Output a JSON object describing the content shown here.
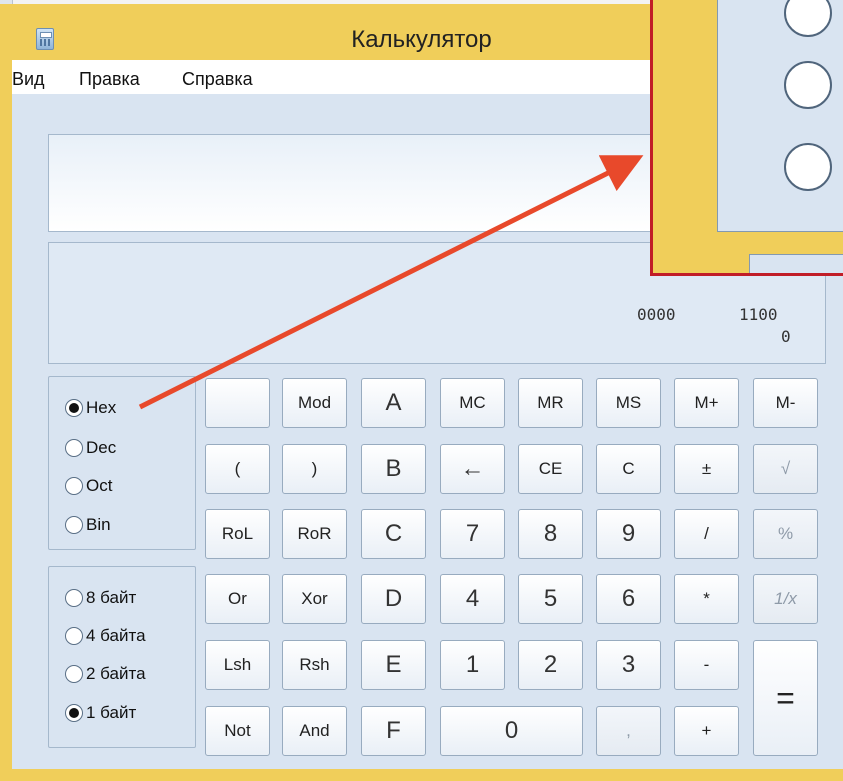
{
  "window": {
    "title": "Калькулятор"
  },
  "menu": {
    "items": [
      "Вид",
      "Правка",
      "Справка"
    ]
  },
  "display": {
    "value": "",
    "bits_top": [
      "0000",
      "1100"
    ],
    "bits_index": "0"
  },
  "base_modes": {
    "options": [
      "Hex",
      "Dec",
      "Oct",
      "Bin"
    ],
    "selected": "Hex"
  },
  "word_sizes": {
    "options": [
      "8 байт",
      "4 байта",
      "2 байта",
      "1 байт"
    ],
    "selected": "1 байт"
  },
  "keypad": {
    "rows": [
      [
        "",
        "Mod",
        "A",
        "MC",
        "MR",
        "MS",
        "M+",
        "M-"
      ],
      [
        "(",
        ")",
        "B",
        "←",
        "CE",
        "C",
        "±",
        "√"
      ],
      [
        "RoL",
        "RoR",
        "C",
        "7",
        "8",
        "9",
        "/",
        "%"
      ],
      [
        "Or",
        "Xor",
        "D",
        "4",
        "5",
        "6",
        "*",
        "1/x"
      ],
      [
        "Lsh",
        "Rsh",
        "E",
        "1",
        "2",
        "3",
        "-",
        "="
      ],
      [
        "Not",
        "And",
        "F",
        "0",
        ",",
        "+"
      ]
    ]
  },
  "annotation": {
    "arrow_color": "#e8492b",
    "frame_color": "#c11d27"
  }
}
